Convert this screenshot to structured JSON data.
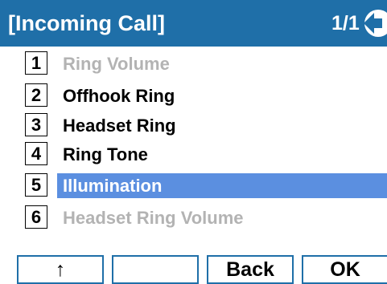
{
  "header": {
    "title": "[Incoming Call]",
    "page_indicator": "1/1"
  },
  "menu": {
    "items": [
      {
        "number": "1",
        "label": "Ring Volume",
        "enabled": false
      },
      {
        "number": "2",
        "label": "Offhook Ring",
        "enabled": true
      },
      {
        "number": "3",
        "label": "Headset Ring",
        "enabled": true
      },
      {
        "number": "4",
        "label": "Ring Tone",
        "enabled": true
      },
      {
        "number": "5",
        "label": "Illumination",
        "enabled": true,
        "selected": true
      },
      {
        "number": "6",
        "label": "Headset Ring Volume",
        "enabled": false
      }
    ]
  },
  "softkeys": {
    "key1": "↑",
    "key2": "",
    "key3": "Back",
    "key4": "OK"
  },
  "colors": {
    "header": "#1f6fa8",
    "selected_row": "#5b8fe0",
    "disabled_text": "#b3b3b3"
  },
  "icons": {
    "page_up": "page-up-arrow-icon"
  }
}
